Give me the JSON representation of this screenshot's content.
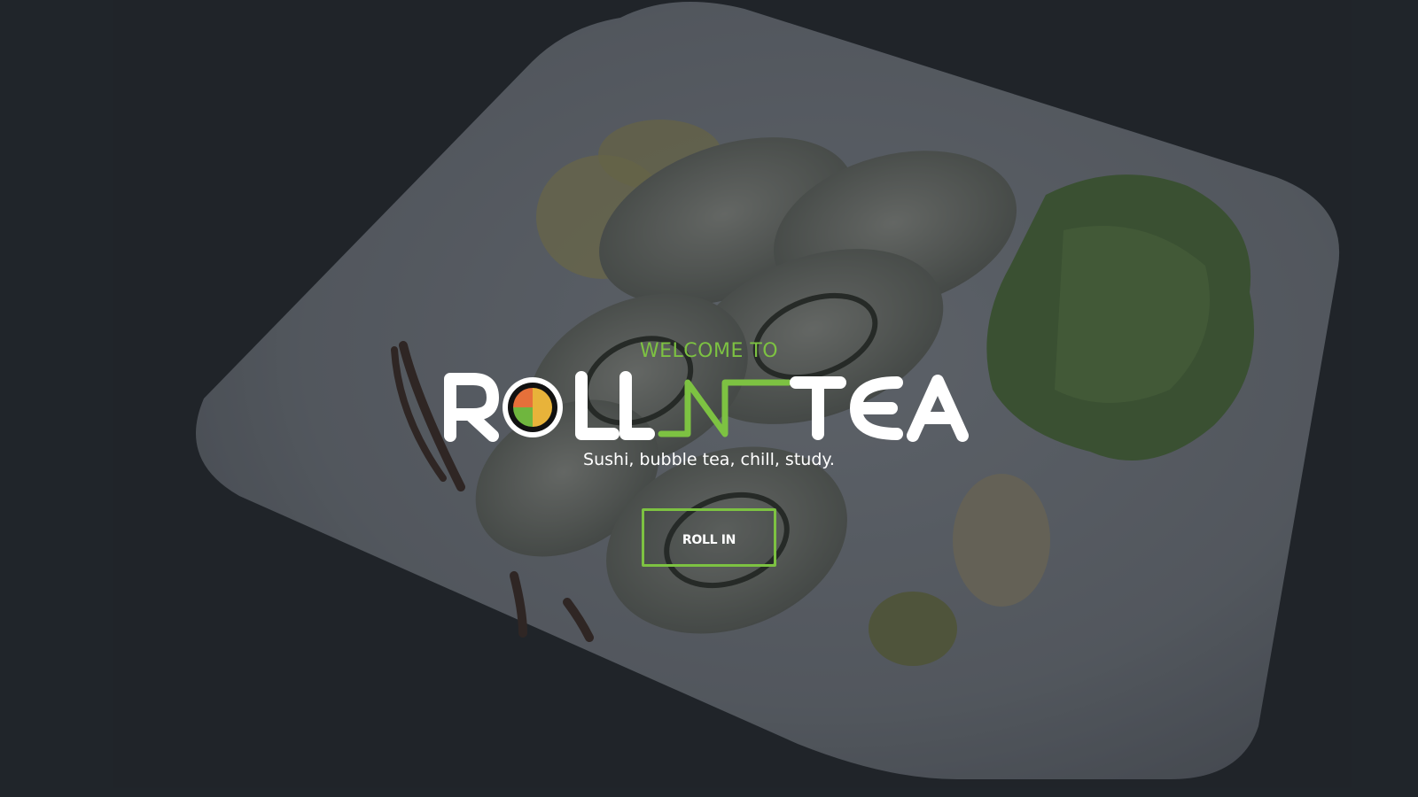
{
  "hero": {
    "welcome": "WELCOME TO",
    "logo_text": "ROLL N TEA",
    "tagline": "Sushi, bubble tea, chill, study.",
    "cta_label": "ROLL IN"
  },
  "colors": {
    "accent": "#7dc242",
    "background": "#1f2328",
    "text": "#ffffff",
    "logo_orange": "#e6703a",
    "logo_yellow": "#e8b33a",
    "logo_green": "#6fb63e"
  }
}
